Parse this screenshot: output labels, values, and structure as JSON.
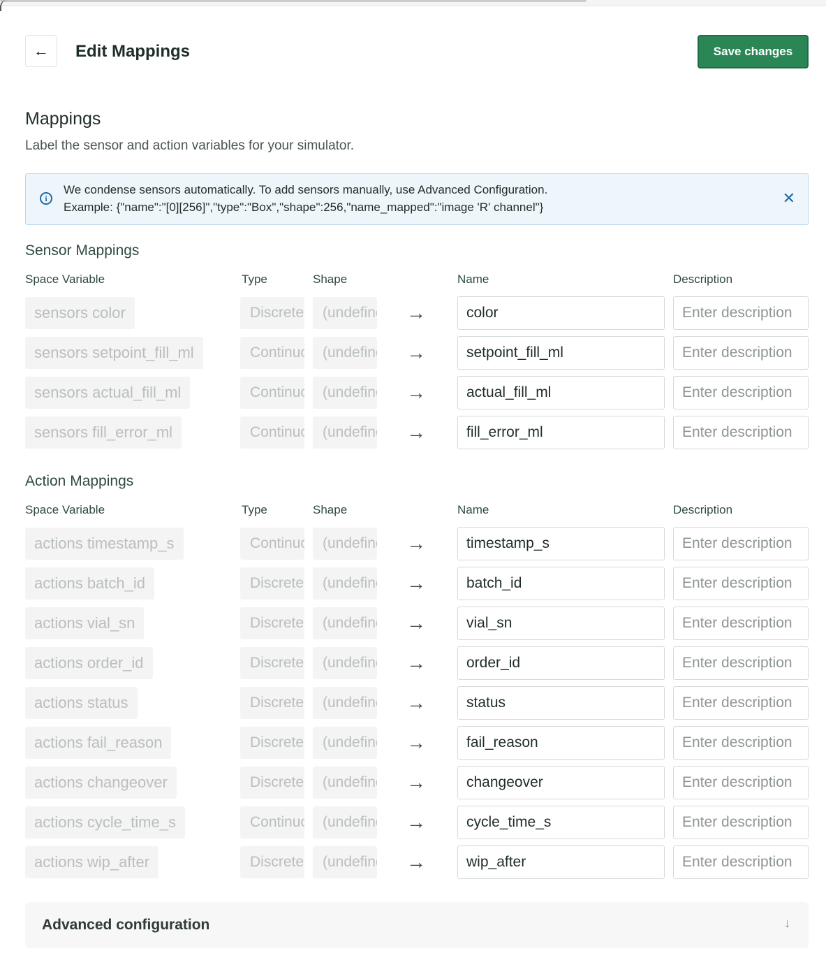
{
  "header": {
    "back_icon": "arrow-left-icon",
    "title": "Edit Mappings",
    "save_label": "Save changes"
  },
  "mappings": {
    "title": "Mappings",
    "subtitle": "Label the sensor and action variables for your simulator."
  },
  "banner": {
    "line1": "We condense sensors automatically. To add sensors manually, use Advanced Configuration.",
    "line2": "Example: {\"name\":\"[0][256]\",\"type\":\"Box\",\"shape\":256,\"name_mapped\":\"image 'R' channel\"}",
    "info_icon": "info-icon",
    "close_icon": "close-icon"
  },
  "columns": {
    "space_variable": "Space Variable",
    "type": "Type",
    "shape": "Shape",
    "name": "Name",
    "description": "Description"
  },
  "sensor_group": {
    "title": "Sensor Mappings",
    "rows": [
      {
        "variable": "sensors color",
        "type": "Discrete",
        "shape": "(undefined)",
        "name": "color",
        "description_placeholder": "Enter description"
      },
      {
        "variable": "sensors setpoint_fill_ml",
        "type": "Continuous",
        "shape": "(undefined)",
        "name": "setpoint_fill_ml",
        "description_placeholder": "Enter description"
      },
      {
        "variable": "sensors actual_fill_ml",
        "type": "Continuous",
        "shape": "(undefined)",
        "name": "actual_fill_ml",
        "description_placeholder": "Enter description"
      },
      {
        "variable": "sensors fill_error_ml",
        "type": "Continuous",
        "shape": "(undefined)",
        "name": "fill_error_ml",
        "description_placeholder": "Enter description"
      }
    ]
  },
  "action_group": {
    "title": "Action Mappings",
    "rows": [
      {
        "variable": "actions timestamp_s",
        "type": "Continuous",
        "shape": "(undefined)",
        "name": "timestamp_s",
        "description_placeholder": "Enter description"
      },
      {
        "variable": "actions batch_id",
        "type": "Discrete",
        "shape": "(undefined)",
        "name": "batch_id",
        "description_placeholder": "Enter description"
      },
      {
        "variable": "actions vial_sn",
        "type": "Discrete",
        "shape": "(undefined)",
        "name": "vial_sn",
        "description_placeholder": "Enter description"
      },
      {
        "variable": "actions order_id",
        "type": "Discrete",
        "shape": "(undefined)",
        "name": "order_id",
        "description_placeholder": "Enter description"
      },
      {
        "variable": "actions status",
        "type": "Discrete",
        "shape": "(undefined)",
        "name": "status",
        "description_placeholder": "Enter description"
      },
      {
        "variable": "actions fail_reason",
        "type": "Discrete",
        "shape": "(undefined)",
        "name": "fail_reason",
        "description_placeholder": "Enter description"
      },
      {
        "variable": "actions changeover",
        "type": "Discrete",
        "shape": "(undefined)",
        "name": "changeover",
        "description_placeholder": "Enter description"
      },
      {
        "variable": "actions cycle_time_s",
        "type": "Continuous",
        "shape": "(undefined)",
        "name": "cycle_time_s",
        "description_placeholder": "Enter description"
      },
      {
        "variable": "actions wip_after",
        "type": "Discrete",
        "shape": "(undefined)",
        "name": "wip_after",
        "description_placeholder": "Enter description"
      }
    ]
  },
  "advanced": {
    "label": "Advanced configuration",
    "chevron_icon": "chevron-down-icon"
  },
  "colors": {
    "save_button": "#2b8655",
    "banner_bg": "#eef6fc",
    "info_accent": "#1f6aa5"
  }
}
